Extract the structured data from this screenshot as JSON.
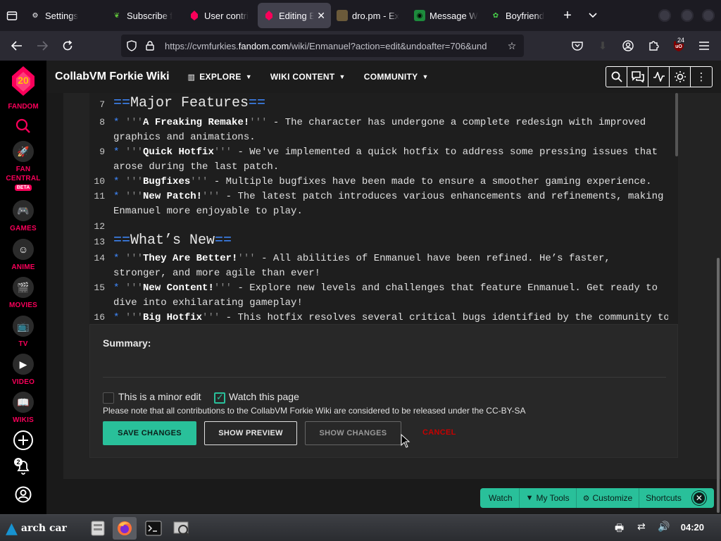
{
  "browser": {
    "tabs": [
      {
        "label": "Settings",
        "icon": "gear-icon"
      },
      {
        "label": "Subscribe f",
        "icon": "leaf-icon"
      },
      {
        "label": "User contri",
        "icon": "fandom-icon"
      },
      {
        "label": "Editing E",
        "icon": "fandom-icon",
        "active": true
      },
      {
        "label": "dro.pm - Ex",
        "icon": "image-icon"
      },
      {
        "label": "Message W",
        "icon": "message-icon"
      },
      {
        "label": "Boyfriend",
        "icon": "character-icon"
      }
    ],
    "url_prefix": "https://cvmfurkies.",
    "url_domain": "fandom.com",
    "url_suffix": "/wiki/Enmanuel?action=edit&undoafter=706&und",
    "extension_badge": "24"
  },
  "fandom_sidebar": {
    "logo_number": "20",
    "logo_label": "FANDOM",
    "items": [
      {
        "label": "FAN CENTRAL",
        "icon": "rocket-icon",
        "badge": "BETA"
      },
      {
        "label": "GAMES",
        "icon": "gamepad-icon"
      },
      {
        "label": "ANIME",
        "icon": "anime-icon"
      },
      {
        "label": "MOVIES",
        "icon": "clapper-icon"
      },
      {
        "label": "TV",
        "icon": "tv-icon"
      },
      {
        "label": "VIDEO",
        "icon": "play-icon"
      },
      {
        "label": "WIKIS",
        "icon": "book-icon"
      }
    ],
    "notification_count": "2"
  },
  "wiki_header": {
    "title": "CollabVM Forkie Wiki",
    "nav": [
      {
        "label": "EXPLORE"
      },
      {
        "label": "WIKI CONTENT"
      },
      {
        "label": "COMMUNITY"
      }
    ]
  },
  "editor": {
    "lines": [
      {
        "num": "7",
        "type": "heading",
        "eq": "==",
        "text": "Major Features"
      },
      {
        "num": "8",
        "type": "item",
        "bold": "A Freaking Remake!",
        "rest": " - The character has undergone a complete redesign with improved graphics and animations."
      },
      {
        "num": "9",
        "type": "item",
        "bold": "Quick Hotfix",
        "rest": " - We've implemented a quick hotfix to address some pressing issues that arose during the last patch."
      },
      {
        "num": "10",
        "type": "item",
        "bold": "Bugfixes",
        "rest": " - Multiple bugfixes have been made to ensure a smoother gaming experience."
      },
      {
        "num": "11",
        "type": "item",
        "bold": "New Patch!",
        "rest": " - The latest patch introduces various enhancements and refinements, making Enmanuel more enjoyable to play."
      },
      {
        "num": "12",
        "type": "blank"
      },
      {
        "num": "13",
        "type": "heading",
        "eq": "==",
        "text": "What’s New"
      },
      {
        "num": "14",
        "type": "item",
        "bold": "They Are Better!",
        "rest": " - All abilities of Enmanuel have been refined. He’s faster, stronger, and more agile than ever!"
      },
      {
        "num": "15",
        "type": "item",
        "bold": "New Content!",
        "rest": " - Explore new levels and challenges that feature Enmanuel. Get ready to dive into exhilarating gameplay!"
      },
      {
        "num": "16",
        "type": "item",
        "bold": "Big Hotfix",
        "rest": " - This hotfix resolves several critical bugs identified by the community to"
      }
    ]
  },
  "edit_form": {
    "summary_label": "Summary:",
    "minor_edit_label": "This is a minor edit",
    "minor_edit_checked": false,
    "watch_label": "Watch this page",
    "watch_checked": true,
    "notice": "Please note that all contributions to the CollabVM Forkie Wiki are considered to be released under the CC-BY-SA",
    "save_label": "SAVE CHANGES",
    "preview_label": "SHOW PREVIEW",
    "changes_label": "SHOW CHANGES",
    "cancel_label": "CANCEL"
  },
  "wiki_toolbar": {
    "watch": "Watch",
    "my_tools": "My Tools",
    "customize": "Customize",
    "shortcuts": "Shortcuts"
  },
  "taskbar": {
    "start_label": "arch car",
    "clock": "04:20"
  },
  "colors": {
    "accent": "#29c09a",
    "fandom_pink": "#fa005a",
    "wikitext_blue": "#3f89ff"
  }
}
